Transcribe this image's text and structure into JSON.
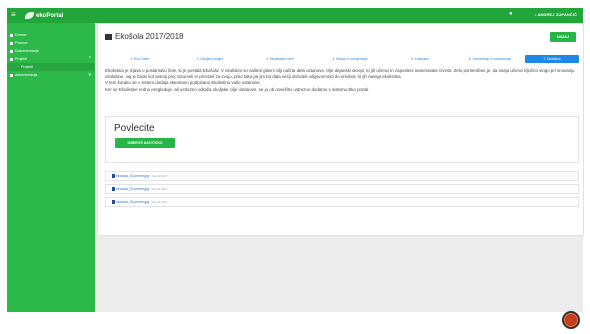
{
  "topbar": {
    "logo_text": "ekoPortal",
    "user_label": "• ANDREJ ZUPANČIČ"
  },
  "sidebar": {
    "items": [
      {
        "label": "Domov"
      },
      {
        "label": "Finance"
      },
      {
        "label": "Dokumentacija"
      },
      {
        "label": "Projekti"
      },
      {
        "label": "Administracija"
      }
    ],
    "sub_item": "Projekti"
  },
  "main": {
    "title": "Ekošola 2017/2018",
    "back_label": "NAZAJ",
    "steps": [
      {
        "label": "1. Eko Odbor"
      },
      {
        "label": "2. Okoljski pregled"
      },
      {
        "label": "3. Ekoakcijski načrt"
      },
      {
        "label": "4. Nadzor in ocenjevanje"
      },
      {
        "label": "5. Kurikulum"
      },
      {
        "label": "6. Obveščanje in ozaveščanje"
      },
      {
        "label": "7. Ekolistina"
      }
    ],
    "desc_1": "Ekolistina je izjava o poslanstvu šole, ki je postala Ekošola. V ekolistini so našteti glavni cilji načrta dela ustanove, trije dejanski ukrepi, ki jih učenci in zaposleni nameravate izvesti. Zelo pomembno je, da imajo učenci ključno vlogo pri snovanju ekolistine, saj je bodo kot avtorji prej razumeli in prevzeli za svojo, prav tako pa jim bo dala večji občutek odgovornosti do vrednot, ki jih navaja ekolistina.",
    "desc_2": "V tem koraku se v sistem dodaja skenirano podpisano Ekolistino vaše ustanove.",
    "desc_3": "Ker se Ekolistine redno pregleduje, ali ustrezno odraža okoljske cilje ustanove, se jo ob osvežitvi ustrezno dodamo v sistemu Eko portal.",
    "download": {
      "title": "Povlecite",
      "button_label": "IZBERITE DATOTEKO"
    },
    "files": [
      {
        "name": "ekosola_01.primer.jpg",
        "meta": "(Sep 11 2017)"
      },
      {
        "name": "ekosola_01.primer.jpg",
        "meta": "(Sep 11 2017)"
      },
      {
        "name": "ekosola_01.primer.jpg",
        "meta": "(Sep 11 2017)"
      }
    ]
  }
}
